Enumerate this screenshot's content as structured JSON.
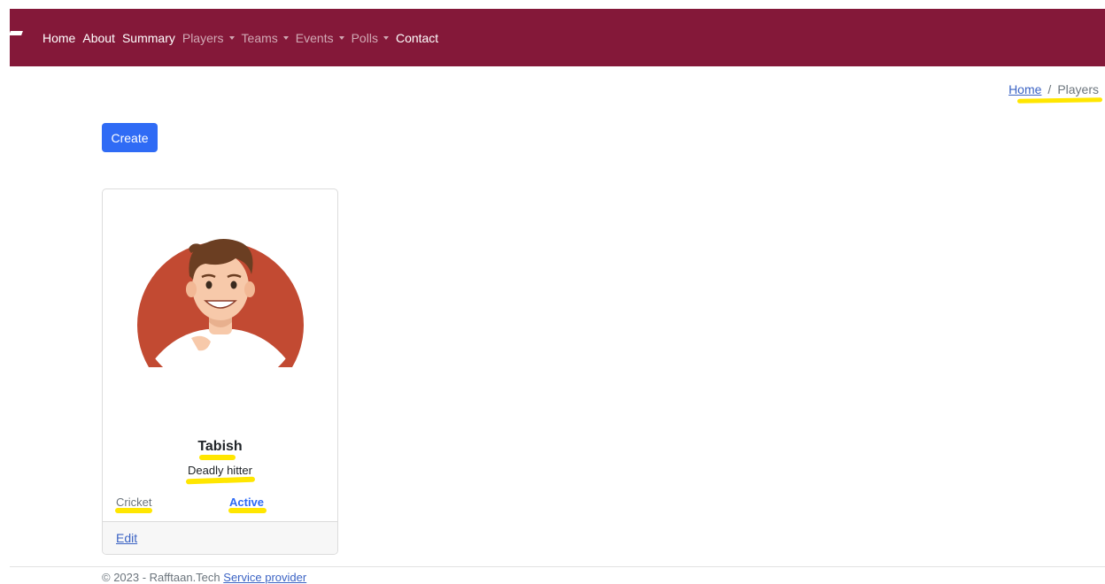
{
  "nav": {
    "items": [
      {
        "label": "Home",
        "dropdown": false
      },
      {
        "label": "About",
        "dropdown": false
      },
      {
        "label": "Summary",
        "dropdown": false
      },
      {
        "label": "Players",
        "dropdown": true
      },
      {
        "label": "Teams",
        "dropdown": true
      },
      {
        "label": "Events",
        "dropdown": true
      },
      {
        "label": "Polls",
        "dropdown": true
      },
      {
        "label": "Contact",
        "dropdown": false
      }
    ]
  },
  "breadcrumb": {
    "home": "Home",
    "separator": "/",
    "current": "Players"
  },
  "toolbar": {
    "create_label": "Create"
  },
  "player_card": {
    "name": "Tabish",
    "description": "Deadly hitter",
    "sport": "Cricket",
    "status": "Active",
    "edit_label": "Edit"
  },
  "footer": {
    "copyright": "© 2023 - Rafftaan.Tech",
    "link_label": "Service provider"
  },
  "colors": {
    "navbar": "#841839",
    "primary": "#2f6bf5",
    "link": "#3b63c4",
    "highlight": "#ffe600",
    "avatar_bg": "#c24a32"
  }
}
